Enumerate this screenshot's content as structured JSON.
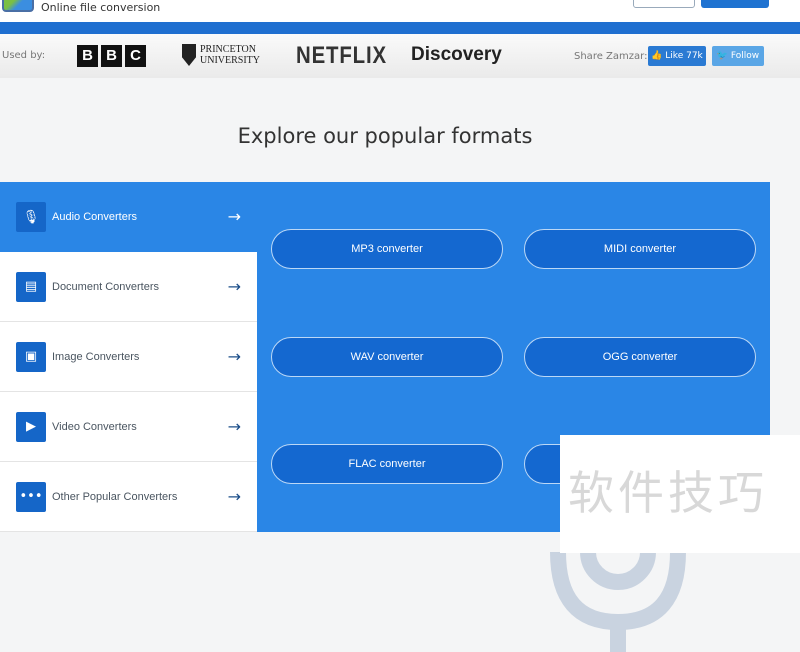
{
  "header": {
    "tagline": "Online file conversion"
  },
  "used_by": {
    "label": "Used by:",
    "logos": [
      "BBC",
      "PRINCETON UNIVERSITY",
      "NETFLIX",
      "Discovery"
    ],
    "share_label": "Share Zamzar:",
    "like": "Like 77k",
    "follow": "Follow"
  },
  "title": "Explore our popular formats",
  "categories": [
    {
      "label": "Audio Converters",
      "icon": "microphone-icon",
      "active": true
    },
    {
      "label": "Document Converters",
      "icon": "document-icon"
    },
    {
      "label": "Image Converters",
      "icon": "image-icon"
    },
    {
      "label": "Video Converters",
      "icon": "play-icon"
    },
    {
      "label": "Other Popular Converters",
      "icon": "more-icon"
    }
  ],
  "converters": [
    "MP3 converter",
    "MIDI converter",
    "WAV converter",
    "OGG converter",
    "FLAC converter"
  ],
  "watermark": "软件技巧",
  "colors": {
    "accent": "#2a86e6",
    "button": "#1468d0",
    "header_bar": "#1f6fd0"
  }
}
